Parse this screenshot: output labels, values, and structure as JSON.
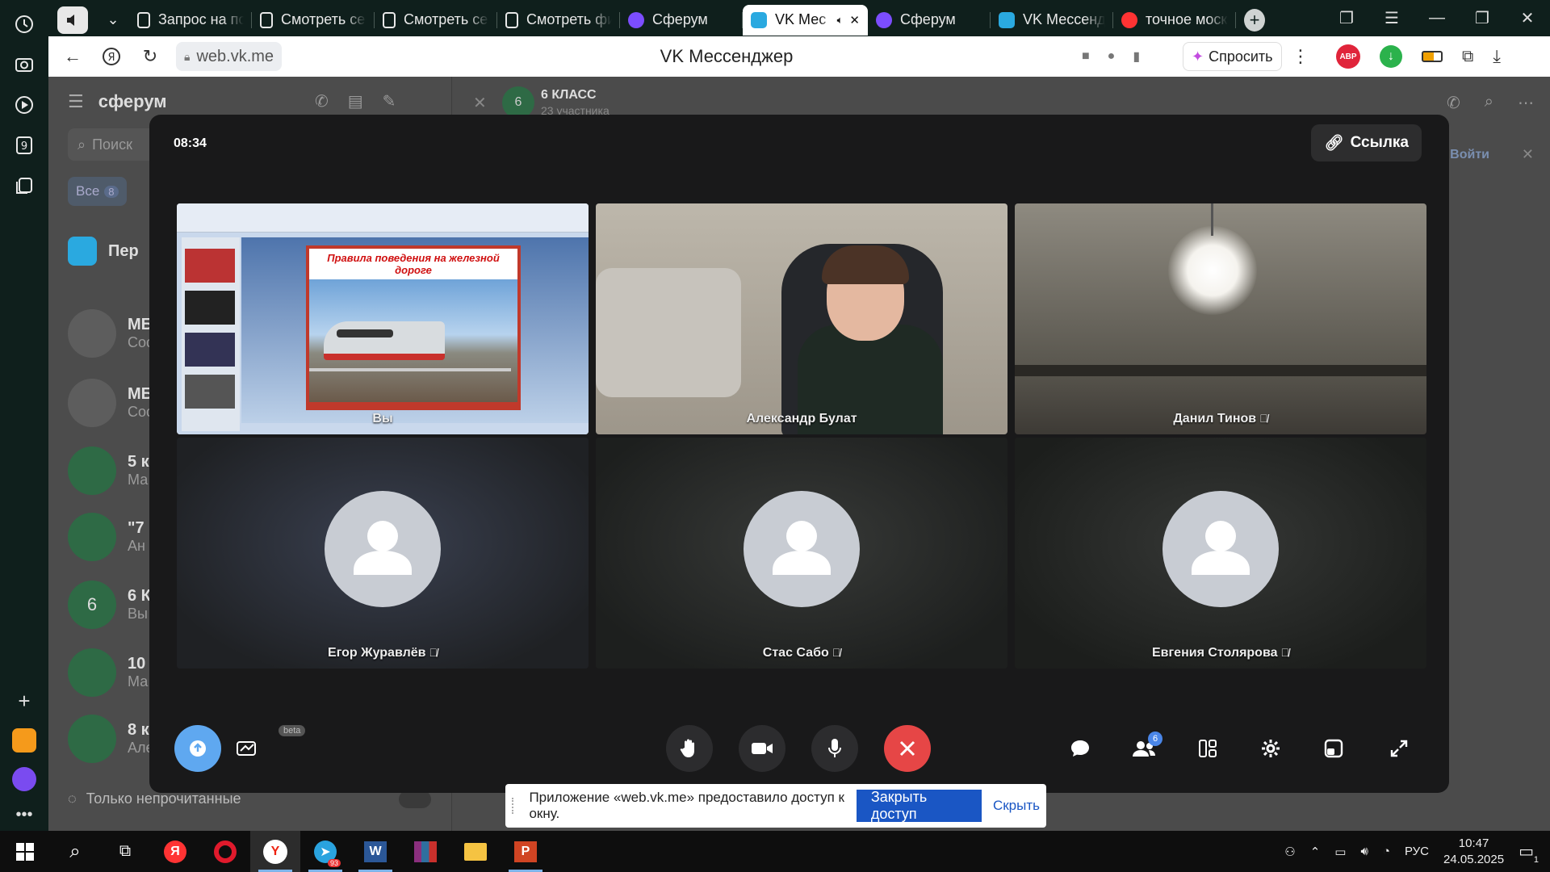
{
  "browser": {
    "tabs": [
      {
        "label": "Запрос на по",
        "icon": "document-icon"
      },
      {
        "label": "Смотреть се",
        "icon": "hd-icon"
      },
      {
        "label": "Смотреть се",
        "icon": "hd-icon"
      },
      {
        "label": "Смотреть фи",
        "icon": "hd-icon"
      },
      {
        "label": "Сферум",
        "icon": "sferum-icon"
      },
      {
        "label": "VK Мес",
        "icon": "vk-messenger-icon",
        "active": true
      },
      {
        "label": "Сферум",
        "icon": "sferum-icon"
      },
      {
        "label": "VK Мессендж",
        "icon": "vk-messenger-icon"
      },
      {
        "label": "точное моск",
        "icon": "yandex-icon"
      }
    ],
    "url": "web.vk.me",
    "page_title": "VK Мессенджер",
    "ask_label": "Спросить",
    "abp_label": "ABP"
  },
  "vk": {
    "brand": "сферум",
    "search_placeholder": "Поиск",
    "filter_all": "Все",
    "filter_all_count": "8",
    "chat_name": "6 КЛАСС",
    "chat_sub": "23 участника",
    "login_label": "Войти",
    "left_rows": [
      {
        "title": "Пер",
        "sub": ""
      },
      {
        "title": "МБ",
        "sub": "Сос"
      },
      {
        "title": "МБ",
        "sub": "Сос"
      },
      {
        "title": "5 к",
        "sub": "Ма"
      },
      {
        "title": "\"7",
        "sub": "Ан"
      },
      {
        "title": "6 К",
        "sub": "Вы",
        "avatar": "6"
      },
      {
        "title": "10",
        "sub": "Ма"
      },
      {
        "title": "8 к",
        "sub": "Але"
      }
    ],
    "unread_only": "Только непрочитанные"
  },
  "call": {
    "timer": "08:34",
    "link_label": "Ссылка",
    "participants": [
      {
        "name": "Вы",
        "muted": false,
        "type": "screen"
      },
      {
        "name": "Александр Булат",
        "muted": false,
        "type": "video-boy"
      },
      {
        "name": "Данил Тинов",
        "muted": true,
        "type": "video-lamp"
      },
      {
        "name": "Егор Журавлёв",
        "muted": true,
        "type": "avatar"
      },
      {
        "name": "Стас Сабо",
        "muted": true,
        "type": "avatar"
      },
      {
        "name": "Евгения Столярова",
        "muted": true,
        "type": "avatar"
      }
    ],
    "slide_title": "Правила поведения на железной дороге",
    "beta_label": "beta",
    "participants_count": "6"
  },
  "share_bar": {
    "message": "Приложение «web.vk.me» предоставило доступ к окну.",
    "close_access": "Закрыть доступ",
    "hide": "Скрыть"
  },
  "taskbar": {
    "telegram_badge": "93",
    "language": "РУС",
    "time": "10:47",
    "date": "24.05.2025",
    "notifications": "1"
  }
}
